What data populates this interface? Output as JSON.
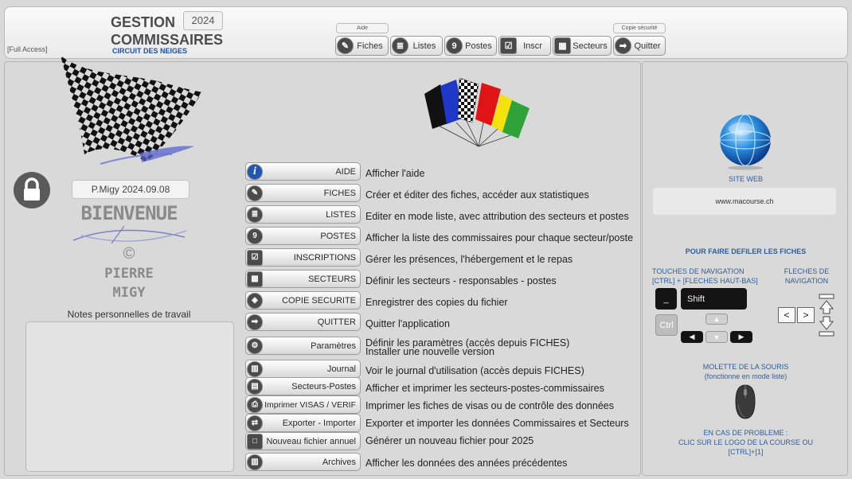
{
  "header": {
    "title_line1": "GESTION",
    "title_line2": "COMMISSAIRES",
    "year": "2024",
    "circuit": "CIRCUIT DES NEIGES",
    "access": "[Full Access]",
    "aide_label": "Aide",
    "copie_label": "Copie sécurité"
  },
  "toolbar": [
    {
      "label": "Fiches",
      "icon": "pen-icon",
      "glyph": "✎"
    },
    {
      "label": "Listes",
      "icon": "list-icon",
      "glyph": "≣"
    },
    {
      "label": "Postes",
      "icon": "number-9-icon",
      "glyph": "9"
    },
    {
      "label": "Inscr",
      "icon": "checkbox-icon",
      "glyph": "☑"
    },
    {
      "label": "Secteurs",
      "icon": "grid-icon",
      "glyph": "▦"
    },
    {
      "label": "Quitter",
      "icon": "exit-arrow-icon",
      "glyph": "➡"
    }
  ],
  "left": {
    "author": "P.Migy 2024.09.08",
    "welcome": "BIENVENUE",
    "copyright": "©",
    "pierre": "PIERRE",
    "migy": "MIGY",
    "notes_label": "Notes personnelles de travail"
  },
  "menu": [
    {
      "label": "AIDE",
      "desc": "Afficher l'aide",
      "icon": "info"
    },
    {
      "label": "FICHES",
      "desc": "Créer et éditer des fiches, accéder aux statistiques",
      "icon": "pen"
    },
    {
      "label": "LISTES",
      "desc": "Editer en mode liste, avec attribution des secteurs et postes",
      "icon": "list"
    },
    {
      "label": "POSTES",
      "desc": "Afficher la liste des commissaires pour chaque secteur/poste",
      "icon": "nine"
    },
    {
      "label": "INSCRIPTIONS",
      "desc": "Gérer les présences, l'hébergement et le repas",
      "icon": "check"
    },
    {
      "label": "SECTEURS",
      "desc": "Définir les secteurs - responsables - postes",
      "icon": "grid"
    },
    {
      "label": "COPIE SECURITE",
      "desc": "Enregistrer des copies du fichier",
      "icon": "copy"
    },
    {
      "label": "QUITTER",
      "desc": "Quitter l'application",
      "icon": "exit"
    },
    {
      "label": "Paramètres",
      "desc": "Définir les paramètres (accès depuis FICHES)",
      "desc2": "Installer une nouvelle version",
      "icon": "gear"
    },
    {
      "label": "Journal",
      "desc": "Voir le journal d'utilisation (accès depuis FICHES)",
      "icon": "book"
    },
    {
      "label": "Secteurs-Postes",
      "desc": "Afficher et imprimer les secteurs-postes-commissaires",
      "icon": "print"
    },
    {
      "label": "Imprimer VISAS / VERIF",
      "desc": "Imprimer les fiches de visas ou de contrôle des données",
      "icon": "printer"
    },
    {
      "label": "Exporter - Importer",
      "desc": "Exporter et importer les données Commissaires et Secteurs",
      "icon": "exchange"
    },
    {
      "label": "Nouveau fichier annuel",
      "desc": "Générer un nouveau fichier pour 2025",
      "icon": "square"
    },
    {
      "label": "Archives",
      "desc": "Afficher les données des années précédentes",
      "icon": "book"
    }
  ],
  "side": {
    "site_web": "SITE WEB",
    "url": "www.macourse.ch",
    "scroll_title": "POUR FAIRE DEFILER LES FICHES",
    "nav_keys_1": "TOUCHES DE NAVIGATION",
    "nav_keys_2": "[CTRL] + [FLECHES HAUT-BAS]",
    "nav_arrows_1": "FLECHES DE",
    "nav_arrows_2": "NAVIGATION",
    "shift": "Shift",
    "ctrl": "Ctrl",
    "mouse_1": "MOLETTE DE LA SOURIS",
    "mouse_2": "(fonctionne en mode liste)",
    "problem_1": "EN CAS DE PROBLEME :",
    "problem_2": "CLIC SUR LE LOGO DE LA COURSE OU",
    "problem_3": "[CTRL]+[1]"
  },
  "colors": {
    "accent_blue": "#1e4fa8",
    "side_text": "#2e5e9c",
    "panel": "#d9d9d9"
  }
}
